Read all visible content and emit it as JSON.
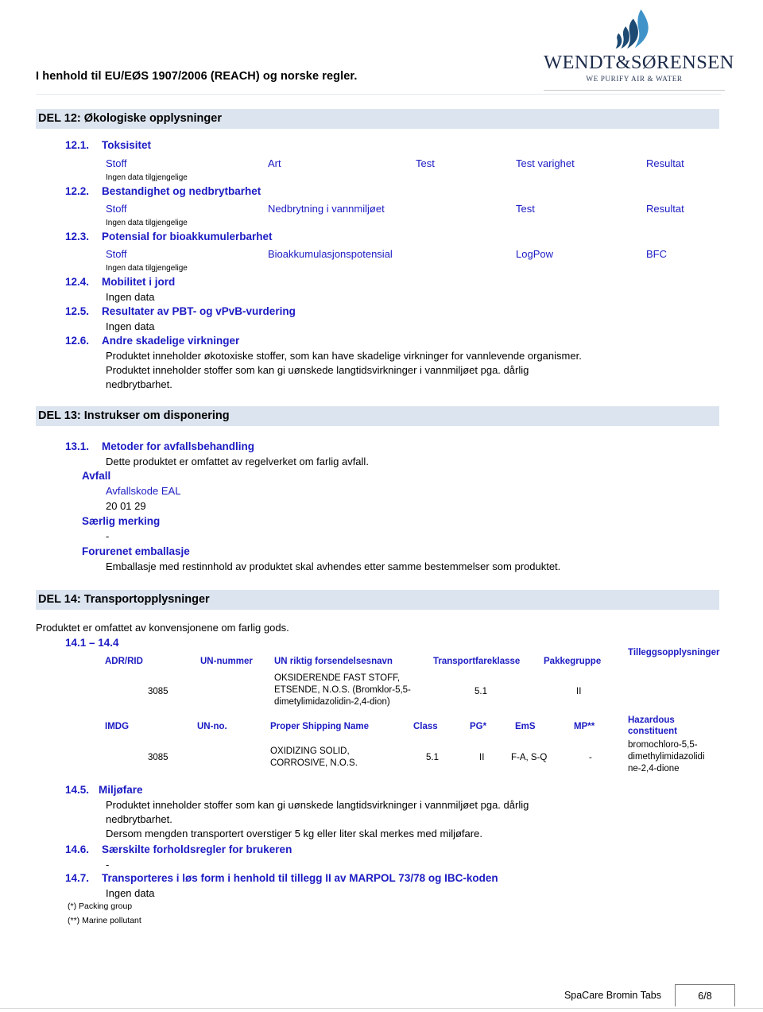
{
  "header": {
    "regulation_line": "I henhold til EU/EØS 1907/2006 (REACH) og norske regler.",
    "logo_word": "WENDT&SØRENSEN",
    "logo_tagline": "WE PURIFY AIR & WATER"
  },
  "colors": {
    "heading_blue": "#1b1bc4",
    "section_bar_bg": "#dce4ef",
    "logo_blue_dark": "#1c4a72",
    "logo_blue_light": "#3f93c8",
    "text_black": "#000000"
  },
  "section12": {
    "bar_title": "DEL 12: Økologiske opplysninger",
    "sub1": {
      "num": "12.1.",
      "title": "Toksisitet",
      "note": "Ingen data tilgjengelige",
      "columns": [
        "Stoff",
        "Art",
        "Test",
        "Test varighet",
        "Resultat"
      ]
    },
    "sub2": {
      "num": "12.2.",
      "title": "Bestandighet og nedbrytbarhet",
      "note": "Ingen data tilgjengelige",
      "columns": [
        "Stoff",
        "Nedbrytning i vannmiljøet",
        "Test",
        "Resultat"
      ]
    },
    "sub3": {
      "num": "12.3.",
      "title": "Potensial for bioakkumulerbarhet",
      "note": "Ingen data tilgjengelige",
      "columns": [
        "Stoff",
        "Bioakkumulasjonspotensial",
        "LogPow",
        "BFC"
      ]
    },
    "sub4": {
      "num": "12.4.",
      "title": "Mobilitet i jord",
      "body": "Ingen data"
    },
    "sub5": {
      "num": "12.5.",
      "title": "Resultater av PBT- og vPvB-vurdering",
      "body": "Ingen data"
    },
    "sub6": {
      "num": "12.6.",
      "title": "Andre skadelige virkninger",
      "body_lines": [
        "Produktet inneholder økotoxiske stoffer, som kan have skadelige virkninger for vannlevende organismer.",
        "Produktet inneholder stoffer som kan gi uønskede langtidsvirkninger i vannmiljøet pga. dårlig",
        "nedbrytbarhet."
      ]
    }
  },
  "section13": {
    "bar_title": "DEL 13: Instrukser om disponering",
    "sub1": {
      "num": "13.1.",
      "title": "Metoder for avfallsbehandling",
      "body": "Dette produktet er omfattet av regelverket om farlig avfall."
    },
    "avfall_heading": "Avfall",
    "avfall_code_label": "Avfallskode EAL",
    "avfall_code_value": "20 01 29",
    "saerlig_heading": "Særlig merking",
    "saerlig_value": "-",
    "forurenet_heading": "Forurenet emballasje",
    "forurenet_body": "Emballasje med restinnhold av produktet skal avhendes etter samme bestemmelser som produktet."
  },
  "section14": {
    "bar_title": "DEL 14: Transportopplysninger",
    "intro": "Produktet er omfattet av konvensjonene om farlig gods.",
    "range_label": "14.1 – 14.4",
    "adr_table": {
      "columns": [
        "ADR/RID",
        "UN-nummer",
        "UN riktig forsendelsesnavn",
        "Transportfareklasse",
        "Pakkegruppe",
        "Tilleggsopplysninger"
      ],
      "row": {
        "mode": "",
        "un_number": "3085",
        "shipping_name_lines": [
          "OKSIDERENDE FAST STOFF,",
          "ETSENDE, N.O.S. (Bromklor-5,5-",
          "dimetylimidazolidin-2,4-dion)"
        ],
        "class": "5.1",
        "packing_group": "II",
        "additional": ""
      }
    },
    "imdg_table": {
      "columns": [
        "IMDG",
        "UN-no.",
        "Proper Shipping Name",
        "Class",
        "PG*",
        "EmS",
        "MP**",
        "Hazardous constituent"
      ],
      "row": {
        "mode": "",
        "un_number": "3085",
        "shipping_name_lines": [
          "OXIDIZING SOLID,",
          "CORROSIVE, N.O.S."
        ],
        "class": "5.1",
        "pg": "II",
        "ems": "F-A, S-Q",
        "mp": "-",
        "hazardous_constituent_lines": [
          "bromochloro-5,5-",
          "dimethylimidazolidi",
          "ne-2,4-dione"
        ]
      }
    },
    "sub5": {
      "num": "14.5.",
      "title": "Miljøfare",
      "body_lines": [
        "Produktet inneholder stoffer som kan gi uønskede langtidsvirkninger i vannmiljøet pga. dårlig",
        "nedbrytbarhet.",
        "Dersom mengden transportert overstiger 5 kg eller liter skal merkes med miljøfare."
      ]
    },
    "sub6": {
      "num": "14.6.",
      "title": "Særskilte forholdsregler for brukeren",
      "body": "-"
    },
    "sub7": {
      "num": "14.7.",
      "title": "Transporteres i løs form i henhold til tillegg II av MARPOL 73/78 og IBC-koden",
      "body": "Ingen data"
    },
    "footnote1": "(*) Packing group",
    "footnote2": "(**) Marine pollutant"
  },
  "footer": {
    "product_name": "SpaCare Bromin Tabs",
    "page_number": "6/8"
  }
}
